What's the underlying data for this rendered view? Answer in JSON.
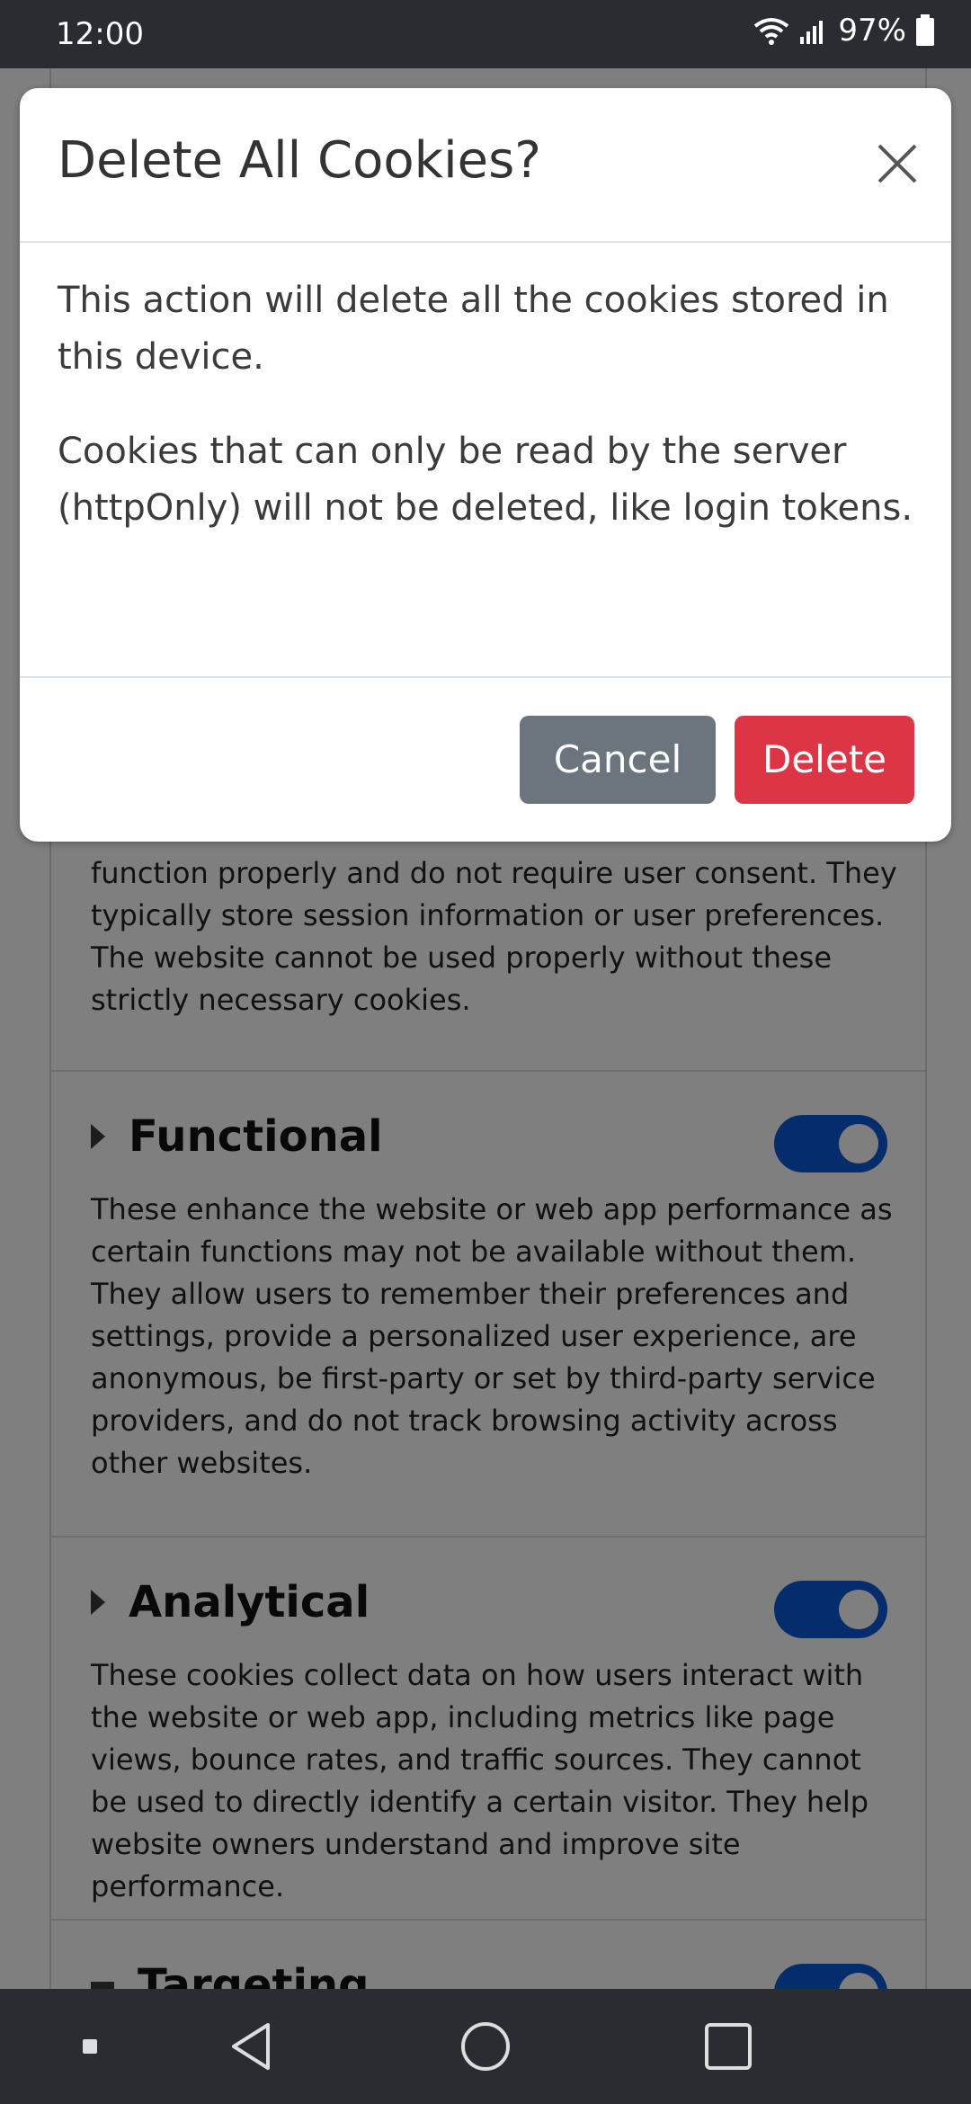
{
  "status_bar": {
    "time": "12:00",
    "battery": "97%"
  },
  "background_page": {
    "partial_text": "function properly and do not require user consent. They typically store session information or user preferences. The website cannot be used properly without these strictly necessary cookies.",
    "sections": [
      {
        "title": "Functional",
        "enabled": true,
        "description": "These enhance the website or web app performance as certain functions may not be available without them. They allow users to remember their preferences and settings, provide a personalized user experience, are anonymous, be first-party or set by third-party service providers, and do not track browsing activity across other websites."
      },
      {
        "title": "Analytical",
        "enabled": true,
        "description": "These cookies collect data on how users interact with the website or web app, including metrics like page views, bounce rates, and traffic sources. They cannot be used to directly identify a certain visitor. They help website owners understand and improve site performance."
      },
      {
        "title": "Targeting",
        "enabled": true
      }
    ]
  },
  "modal": {
    "title": "Delete All Cookies?",
    "body_1": "This action will delete all the cookies stored in this device.",
    "body_2": "Cookies that can only be read by the server (httpOnly) will not be deleted, like login tokens.",
    "cancel_label": "Cancel",
    "delete_label": "Delete"
  },
  "colors": {
    "cancel": "#6c757d",
    "delete": "#dc3545",
    "toggle_on": "#0d5bd6"
  },
  "icons": {
    "close": "close-icon",
    "back": "back-triangle-icon",
    "home": "home-circle-icon",
    "recents": "recents-square-icon"
  }
}
